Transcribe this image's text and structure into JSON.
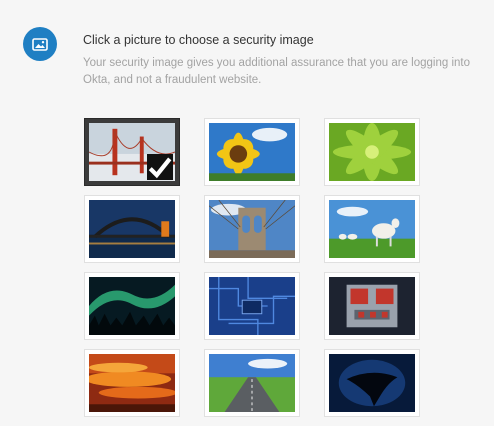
{
  "header": {
    "icon": "image-icon",
    "title": "Click a picture to choose a security image",
    "description": "Your security image gives you additional assurance that you are logging into Okta, and not a fraudulent website."
  },
  "colors": {
    "accent": "#1f7fc3",
    "panel_background": "#f6f6f6",
    "selected_frame": "#3b3b3b"
  },
  "security_images": [
    {
      "subject": "golden-gate-bridge-in-fog",
      "selected": true
    },
    {
      "subject": "sunflower",
      "selected": false
    },
    {
      "subject": "green-succulent",
      "selected": false
    },
    {
      "subject": "harbour-bridge-at-night",
      "selected": false
    },
    {
      "subject": "brooklyn-bridge",
      "selected": false
    },
    {
      "subject": "sheep-on-grass",
      "selected": false
    },
    {
      "subject": "aurora-over-forest",
      "selected": false
    },
    {
      "subject": "circuit-board",
      "selected": false
    },
    {
      "subject": "toy-robot",
      "selected": false
    },
    {
      "subject": "orange-sunset-clouds",
      "selected": false
    },
    {
      "subject": "open-road",
      "selected": false
    },
    {
      "subject": "manta-ray",
      "selected": false
    }
  ],
  "selected_mark": "checkmark-icon"
}
